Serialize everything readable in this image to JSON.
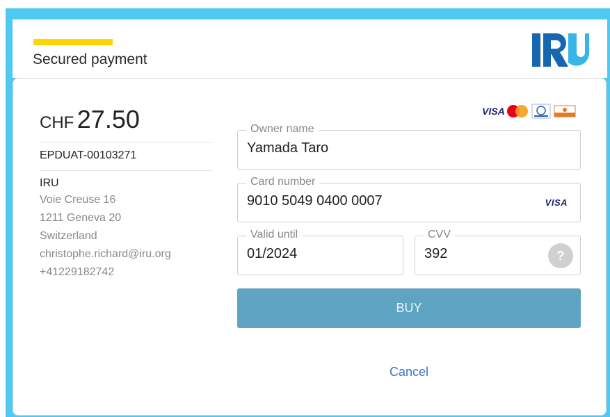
{
  "header": {
    "title": "Secured payment",
    "logo_text": "IRU"
  },
  "summary": {
    "currency": "CHF",
    "amount": "27.50",
    "reference": "EPDUAT-00103271",
    "company": "IRU",
    "address_lines": [
      "Voie Creuse 16",
      "1211 Geneva 20",
      "Switzerland",
      "christophe.richard@iru.org",
      "+41229182742"
    ]
  },
  "brands": {
    "visa": "VISA",
    "icons": [
      "visa-icon",
      "mastercard-icon",
      "diners-icon",
      "discover-icon"
    ]
  },
  "form": {
    "owner": {
      "label": "Owner name",
      "value": "Yamada Taro"
    },
    "card": {
      "label": "Card number",
      "value": "9010 5049 0400 0007",
      "brand": "VISA"
    },
    "valid": {
      "label": "Valid until",
      "value": "01/2024"
    },
    "cvv": {
      "label": "CVV",
      "value": "392",
      "help": "?"
    }
  },
  "actions": {
    "buy_label": "BUY",
    "cancel_label": "Cancel"
  },
  "colors": {
    "frame": "#4ec9f2",
    "accent": "#ffd500",
    "buy": "#5fa4c2",
    "link": "#3a73cf",
    "logo_dark": "#1766b0",
    "logo_light": "#36b5e9"
  }
}
